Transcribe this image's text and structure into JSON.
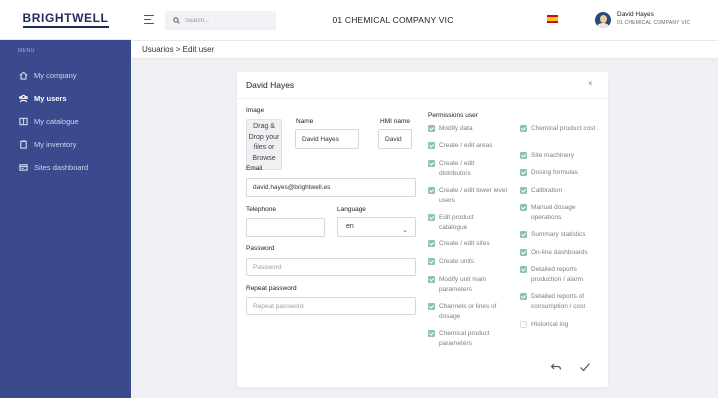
{
  "brand": {
    "logo_text": "BRIGHTWELL"
  },
  "sidebar": {
    "menu_label": "MENU",
    "items": [
      {
        "label": "My company",
        "icon": "home-icon",
        "active": false
      },
      {
        "label": "My users",
        "icon": "users-icon",
        "active": true
      },
      {
        "label": "My catalogue",
        "icon": "book-icon",
        "active": false
      },
      {
        "label": "My inventory",
        "icon": "clipboard-icon",
        "active": false
      },
      {
        "label": "Sites dashboard",
        "icon": "dashboard-icon",
        "active": false
      }
    ]
  },
  "topbar": {
    "search_placeholder": "Search...",
    "company_title": "01 CHEMICAL COMPANY VIC",
    "language_flag": "spain-flag-icon",
    "user_name": "David Hayes",
    "user_company": "01 CHEMICAL COMPANY VIC"
  },
  "breadcrumb": "Usuarios > Edit user",
  "modal": {
    "title": "David Hayes",
    "close_glyph": "×",
    "image_label": "Image",
    "dropzone_text": "Drag & Drop your files or Browse",
    "name_label": "Name",
    "name_value": "David Hayes",
    "hmi_label": "HMI name",
    "hmi_value": "David",
    "email_label": "Email",
    "email_value": "david.hayes@brightwell.es",
    "telephone_label": "Telephone",
    "telephone_value": "",
    "language_label": "Language",
    "language_value": "en",
    "password_label": "Password",
    "password_placeholder": "Password",
    "repeat_password_label": "Repeat password",
    "repeat_password_placeholder": "Repeat password",
    "permissions_title": "Permissions user",
    "permissions_left": [
      {
        "label": "Modify data",
        "checked": true
      },
      {
        "label": "Create / edit areas",
        "checked": true
      },
      {
        "label": "Create / edit distributors",
        "checked": true
      },
      {
        "label": "Create / edit lower level users",
        "checked": true
      },
      {
        "label": "Edit product catalogue",
        "checked": true
      },
      {
        "label": "Create / edit sites",
        "checked": true
      },
      {
        "label": "Create units",
        "checked": true
      },
      {
        "label": "Modify unit main parameters",
        "checked": true
      },
      {
        "label": "Channels or lines of dosage",
        "checked": true
      },
      {
        "label": "Chemical product parameters",
        "checked": true
      }
    ],
    "permissions_right": [
      {
        "label": "Chemical product cost",
        "checked": true
      },
      {
        "label": "Site machinery",
        "checked": true
      },
      {
        "label": "Dosing formulas",
        "checked": true
      },
      {
        "label": "Calibration",
        "checked": true
      },
      {
        "label": "Manual dosage operations",
        "checked": true
      },
      {
        "label": "Summary statistics",
        "checked": true
      },
      {
        "label": "On-line dashboards",
        "checked": true
      },
      {
        "label": "Detailed reports production / alarm",
        "checked": true
      },
      {
        "label": "Detailed reports of consumption / cost",
        "checked": true
      },
      {
        "label": "Historical log",
        "checked": false
      }
    ],
    "back_icon": "undo-arrow-icon",
    "confirm_icon": "checkmark-icon"
  },
  "colors": {
    "sidebar_bg": "#3a4a8c",
    "checkbox_checked": "#8ec0b4",
    "page_bg": "#eef0f4"
  }
}
